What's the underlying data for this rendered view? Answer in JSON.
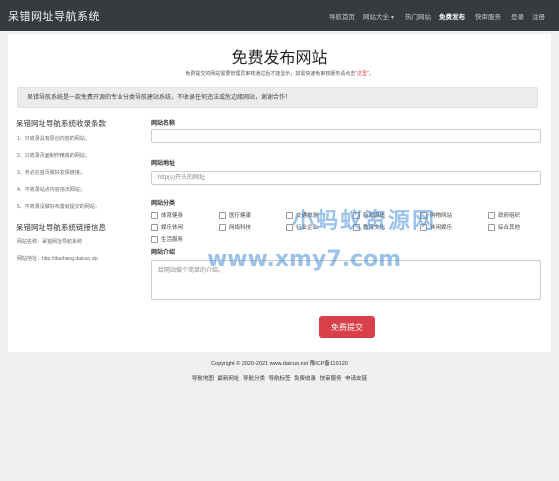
{
  "brand": "呆错网址导航系统",
  "nav": [
    {
      "label": "导航首页",
      "active": false
    },
    {
      "label": "网站大全",
      "active": false,
      "dropdown": true
    },
    {
      "label": "热门网站",
      "active": false
    },
    {
      "label": "免费发布",
      "active": true
    },
    {
      "label": "快审服务",
      "active": false
    },
    {
      "label": "登录",
      "active": false
    },
    {
      "label": "注册",
      "active": false
    }
  ],
  "page": {
    "title": "免费发布网站",
    "desc_prefix": "免费提交的网站需要管理员审核通过后才能显示，如需快速免审核服务请点击",
    "desc_link": "\"这里\"",
    "desc_suffix": "。",
    "notice": "呆错导航系统是一款免费开源的专业分类导航建站系统，不收录任何违法或危边缘网站，谢谢合作！"
  },
  "sidebar": {
    "rules_title": "呆错网址导航系统收录条款",
    "rules": [
      "1、只收录具有原创内容的网站；",
      "2、只收录页面制作精良的网站；",
      "3、务必在首页做好友情链接；",
      "4、不收录站点内容违法网站；",
      "5、不收录没做好布置就提交的网站；"
    ],
    "link_title": "呆错网址导航系统链接信息",
    "link_name": "网站名称：呆错网址导航系统",
    "link_url": "网站地址：http://daohang.daicuo.vip"
  },
  "form": {
    "name_label": "网站名称",
    "name_value": "",
    "url_label": "网站地址",
    "url_placeholder": "http(s)开头的网址",
    "category_label": "网站分类",
    "categories": [
      "体育健身",
      "医疗健康",
      "交通旅游",
      "新闻媒体",
      "购物网站",
      "政府组织",
      "娱乐休闲",
      "网络科技",
      "行业企业",
      "教育文化",
      "休闲娱乐",
      "综合其他",
      "生活服务"
    ],
    "desc_label": "网站介绍",
    "desc_placeholder": "给网站做个简单的介绍。",
    "submit": "免费提交"
  },
  "watermark": {
    "cn": "小蚂蚁资源网",
    "url": "www.xmy7.com"
  },
  "footer": {
    "copyright": "Copyright © 2020-2021 www.daicuo.net 豫ICP备119120",
    "links": [
      "导航地图",
      "最新网址",
      "导航分类",
      "导航标签",
      "免费收录",
      "快审服务",
      "申请友链"
    ]
  }
}
